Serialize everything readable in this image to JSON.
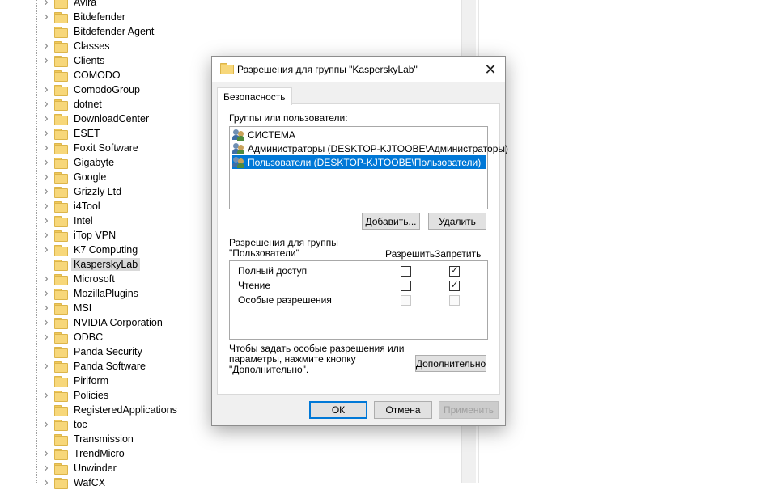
{
  "tree": {
    "items": [
      {
        "label": "Avira",
        "expandable": true
      },
      {
        "label": "Bitdefender",
        "expandable": true
      },
      {
        "label": "Bitdefender Agent",
        "expandable": false
      },
      {
        "label": "Classes",
        "expandable": true
      },
      {
        "label": "Clients",
        "expandable": true
      },
      {
        "label": "COMODO",
        "expandable": false
      },
      {
        "label": "ComodoGroup",
        "expandable": true
      },
      {
        "label": "dotnet",
        "expandable": true
      },
      {
        "label": "DownloadCenter",
        "expandable": true
      },
      {
        "label": "ESET",
        "expandable": true
      },
      {
        "label": "Foxit Software",
        "expandable": true
      },
      {
        "label": "Gigabyte",
        "expandable": true
      },
      {
        "label": "Google",
        "expandable": true
      },
      {
        "label": "Grizzly Ltd",
        "expandable": true
      },
      {
        "label": "i4Tool",
        "expandable": true
      },
      {
        "label": "Intel",
        "expandable": true
      },
      {
        "label": "iTop VPN",
        "expandable": true
      },
      {
        "label": "K7 Computing",
        "expandable": true
      },
      {
        "label": "KasperskyLab",
        "expandable": false,
        "selected": true
      },
      {
        "label": "Microsoft",
        "expandable": true
      },
      {
        "label": "MozillaPlugins",
        "expandable": true
      },
      {
        "label": "MSI",
        "expandable": true
      },
      {
        "label": "NVIDIA Corporation",
        "expandable": true
      },
      {
        "label": "ODBC",
        "expandable": true
      },
      {
        "label": "Panda Security",
        "expandable": false
      },
      {
        "label": "Panda Software",
        "expandable": true
      },
      {
        "label": "Piriform",
        "expandable": false
      },
      {
        "label": "Policies",
        "expandable": true
      },
      {
        "label": "RegisteredApplications",
        "expandable": false
      },
      {
        "label": "toc",
        "expandable": true
      },
      {
        "label": "Transmission",
        "expandable": false
      },
      {
        "label": "TrendMicro",
        "expandable": true
      },
      {
        "label": "Unwinder",
        "expandable": true
      },
      {
        "label": "WafCX",
        "expandable": true
      }
    ]
  },
  "dialog": {
    "title": "Разрешения для группы \"KasperskyLab\"",
    "close_glyph": "✕",
    "tab_label": "Безопасность",
    "groups_label": "Группы или пользователи:",
    "users": [
      {
        "name": "СИСТЕМА",
        "selected": false
      },
      {
        "name": "Администраторы (DESKTOP-KJTOOBE\\Администраторы)",
        "selected": false
      },
      {
        "name": "Пользователи (DESKTOP-KJTOOBE\\Пользователи)",
        "selected": true
      }
    ],
    "add_button": "Добавить...",
    "remove_button": "Удалить",
    "perm_header_line1": "Разрешения для группы",
    "perm_header_line2": "\"Пользователи\"",
    "allow_col": "Разрешить",
    "deny_col": "Запретить",
    "permissions": [
      {
        "name": "Полный доступ",
        "allow": false,
        "deny": true,
        "disabled": false
      },
      {
        "name": "Чтение",
        "allow": false,
        "deny": true,
        "disabled": false
      },
      {
        "name": "Особые разрешения",
        "allow": false,
        "deny": false,
        "disabled": true
      }
    ],
    "hint_text": "Чтобы задать особые разрешения или параметры, нажмите кнопку \"Дополнительно\".",
    "advanced_button": "Дополнительно",
    "ok_button": "ОК",
    "cancel_button": "Отмена",
    "apply_button": "Применить",
    "check_glyph": "✓",
    "colors": {
      "selection": "#0078d7",
      "folder": "#f7d77a"
    }
  }
}
